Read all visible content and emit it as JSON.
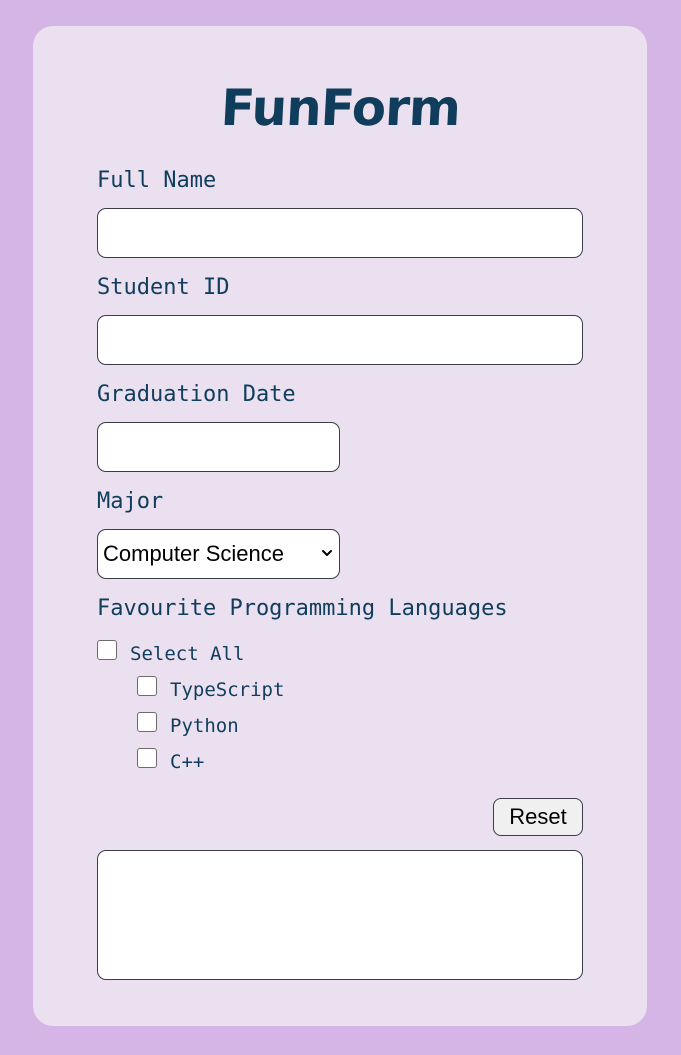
{
  "form": {
    "title": "FunForm",
    "fields": {
      "full_name": {
        "label": "Full Name",
        "value": ""
      },
      "student_id": {
        "label": "Student ID",
        "value": ""
      },
      "graduation_date": {
        "label": "Graduation Date",
        "value": ""
      },
      "major": {
        "label": "Major",
        "selected": "Computer Science"
      }
    },
    "languages": {
      "label": "Favourite Programming Languages",
      "select_all": {
        "label": "Select All",
        "checked": false
      },
      "options": [
        {
          "label": "TypeScript",
          "checked": false
        },
        {
          "label": "Python",
          "checked": false
        },
        {
          "label": "C++",
          "checked": false
        }
      ]
    },
    "reset_label": "Reset",
    "output_value": ""
  },
  "colors": {
    "page_background": "#d5b5e5",
    "card_background": "#ebe0ef",
    "text": "#0f3d5b"
  },
  "icons": {
    "select_arrow": "chevron-down-icon"
  }
}
